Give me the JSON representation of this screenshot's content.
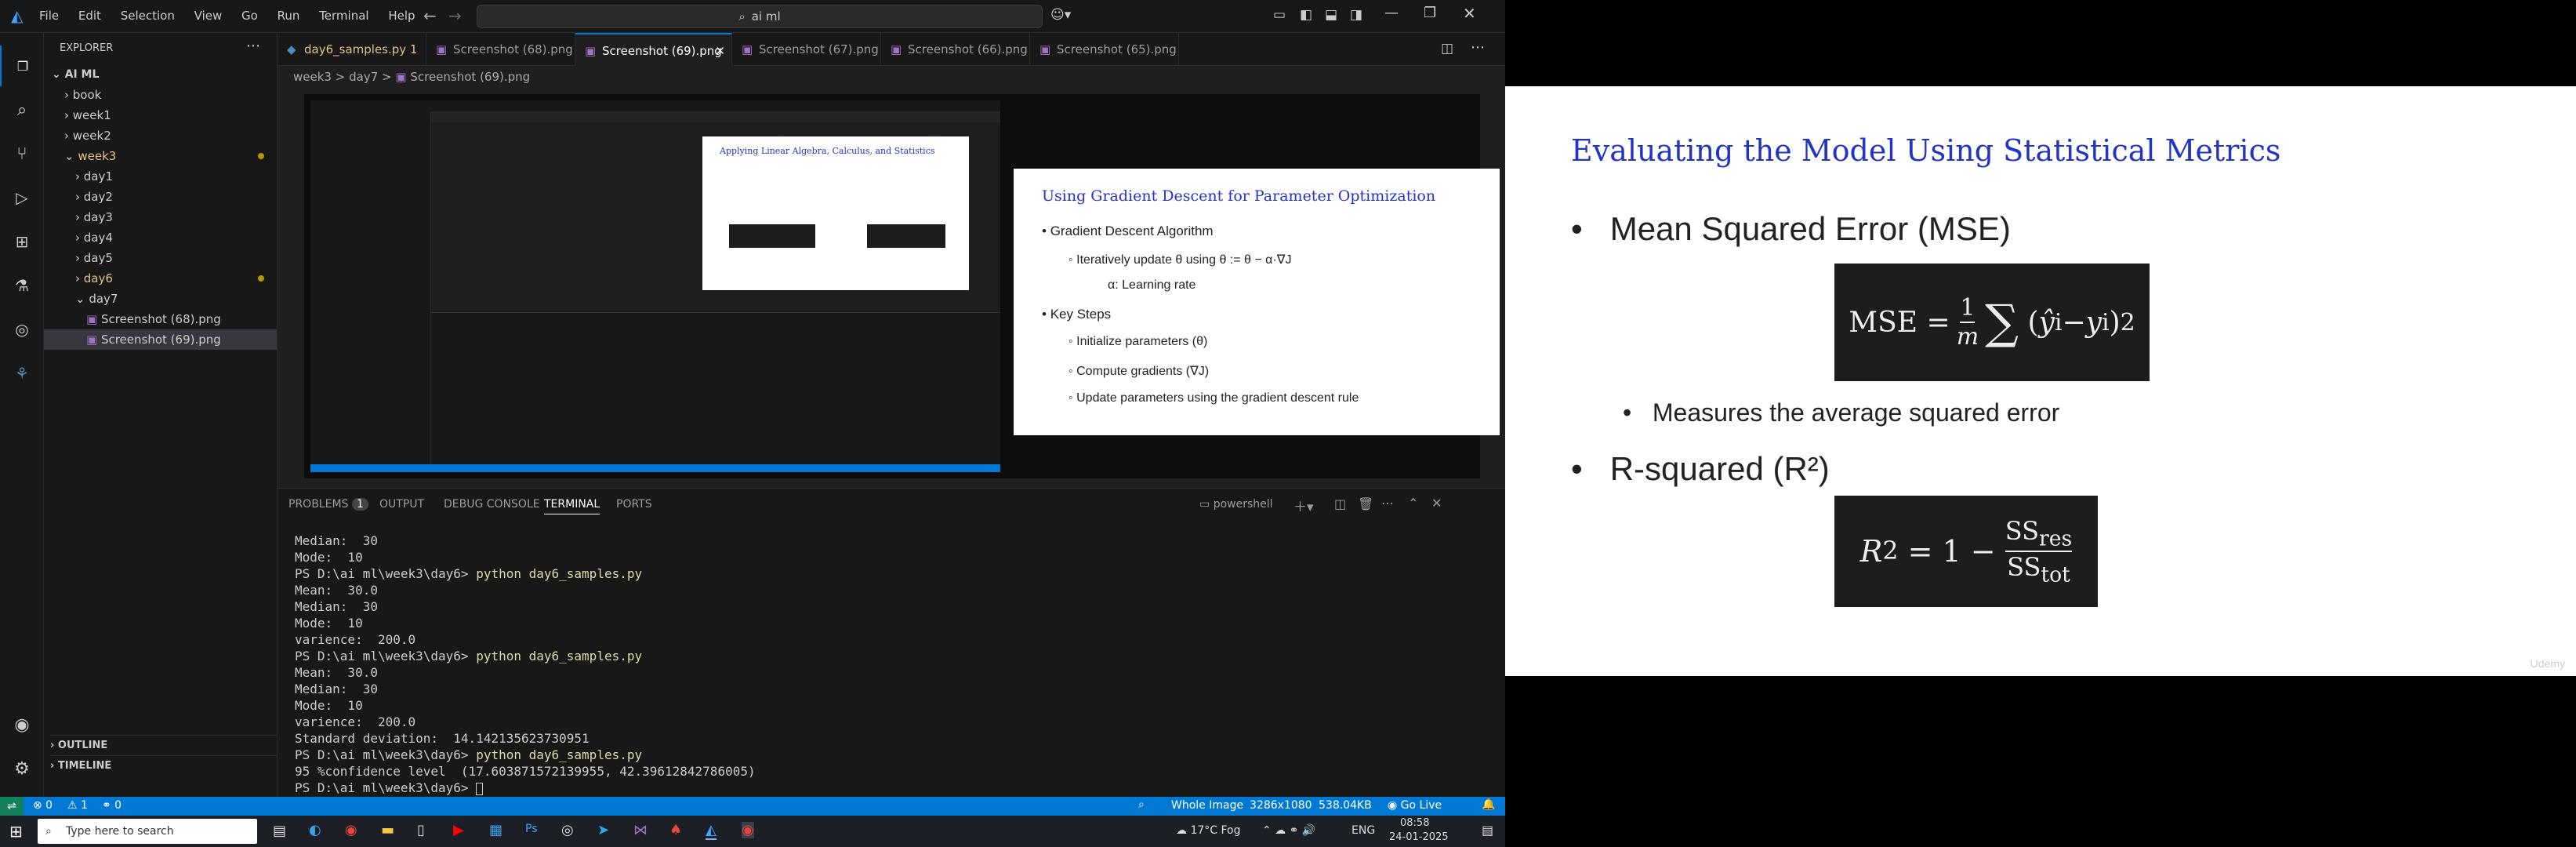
{
  "titlebar": {
    "menu": [
      "File",
      "Edit",
      "Selection",
      "View",
      "Go",
      "Run",
      "Terminal",
      "Help"
    ],
    "search": "ai ml"
  },
  "sidebar": {
    "header": "EXPLORER",
    "root": "AI ML",
    "items": [
      {
        "label": "book",
        "indent": 1,
        "type": "folder",
        "collapsed": true
      },
      {
        "label": "week1",
        "indent": 1,
        "type": "folder",
        "collapsed": true
      },
      {
        "label": "week2",
        "indent": 1,
        "type": "folder",
        "collapsed": true
      },
      {
        "label": "week3",
        "indent": 1,
        "type": "folder",
        "collapsed": false,
        "modified": true
      },
      {
        "label": "day1",
        "indent": 2,
        "type": "folder",
        "collapsed": true
      },
      {
        "label": "day2",
        "indent": 2,
        "type": "folder",
        "collapsed": true
      },
      {
        "label": "day3",
        "indent": 2,
        "type": "folder",
        "collapsed": true
      },
      {
        "label": "day4",
        "indent": 2,
        "type": "folder",
        "collapsed": true
      },
      {
        "label": "day5",
        "indent": 2,
        "type": "folder",
        "collapsed": true
      },
      {
        "label": "day6",
        "indent": 2,
        "type": "folder",
        "collapsed": true,
        "modified": true
      },
      {
        "label": "day7",
        "indent": 2,
        "type": "folder",
        "collapsed": false
      },
      {
        "label": "Screenshot (68).png",
        "indent": 3,
        "type": "file"
      },
      {
        "label": "Screenshot (69).png",
        "indent": 3,
        "type": "file",
        "selected": true
      }
    ],
    "outline": "OUTLINE",
    "timeline": "TIMELINE"
  },
  "tabs": [
    {
      "label": "day6_samples.py 1",
      "active": false,
      "modified": true
    },
    {
      "label": "Screenshot (68).png",
      "active": false
    },
    {
      "label": "Screenshot (69).png",
      "active": true
    },
    {
      "label": "Screenshot (67).png",
      "active": false
    },
    {
      "label": "Screenshot (66).png",
      "active": false
    },
    {
      "label": "Screenshot (65).png",
      "active": false
    }
  ],
  "breadcrumb": {
    "parts": [
      "week3",
      ">",
      "day7",
      ">",
      "Screenshot (69).png"
    ]
  },
  "inner_slide": {
    "title": "Applying Linear Algebra, Calculus, and Statistics",
    "right_title": "Using Gradient Descent for Parameter Optimization",
    "right_bullets": [
      "Gradient Descent Algorithm",
      "Iteratively update θ using θ := θ − α·∇J",
      "α: Learning rate",
      "Key Steps",
      "Initialize parameters (θ)",
      "Compute gradients (∇J)",
      "Update parameters using the gradient descent rule"
    ]
  },
  "panel": {
    "tabs": [
      "PROBLEMS",
      "OUTPUT",
      "DEBUG CONSOLE",
      "TERMINAL",
      "PORTS"
    ],
    "problems_count": "1",
    "shell": "powershell",
    "terminal_lines": [
      "Median:  30",
      "Mode:  10",
      "PS D:\\ai ml\\week3\\day6> |python day6_samples.py",
      "Mean:  30.0",
      "Median:  30",
      "Mode:  10",
      "varience:  200.0",
      "PS D:\\ai ml\\week3\\day6> |python day6_samples.py",
      "Mean:  30.0",
      "Median:  30",
      "Mode:  10",
      "varience:  200.0",
      "Standard deviation:  14.142135623730951",
      "PS D:\\ai ml\\week3\\day6> |python day6_samples.py",
      "95 %confidence level  (17.603871572139955, 42.39612842786005)",
      "PS D:\\ai ml\\week3\\day6> "
    ]
  },
  "statusbar": {
    "left": [
      "⊗ 0",
      "⚠ 1",
      "⚭ 0"
    ],
    "right": [
      "Whole Image",
      "3286x1080",
      "538.04KB",
      "Go Live"
    ]
  },
  "taskbar": {
    "search": "Type here to search",
    "weather": "17°C  Fog",
    "lang": "ENG",
    "time": "08:58",
    "date": "24-01-2025"
  },
  "slide": {
    "title": "Evaluating the Model Using Statistical Metrics",
    "bullet1": "Mean Squared Error (MSE)",
    "sub1": "Measures the average squared error",
    "bullet2": "R-squared (R²)",
    "watermark": "Udemy"
  }
}
